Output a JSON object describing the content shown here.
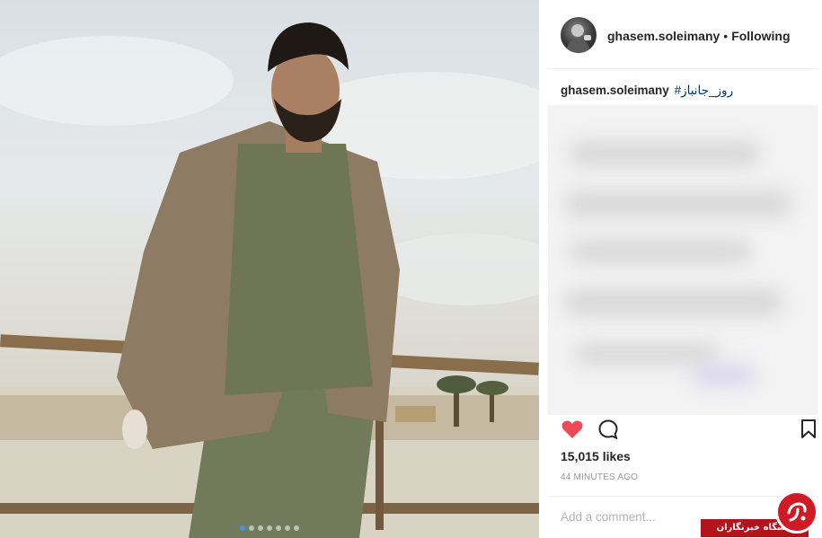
{
  "post": {
    "username": "ghasem.soleimany",
    "follow_separator": "•",
    "follow_status": "Following",
    "caption_username": "ghasem.soleimany",
    "caption_hashtag": "#روز_جانباز",
    "likes": "15,015 likes",
    "timestamp": "44 MINUTES AGO",
    "comment_placeholder": "Add a comment...",
    "carousel": {
      "count": 7,
      "active_index": 0
    }
  },
  "watermark": {
    "text": "باشگاه خبرنگاران"
  },
  "colors": {
    "like_red": "#ed4956",
    "hashtag_blue": "#003569",
    "carousel_active": "#3897f0",
    "watermark_red": "#b3141c"
  },
  "icons": {
    "like": "heart-filled-icon",
    "comment": "comment-bubble-icon",
    "save": "bookmark-icon"
  }
}
